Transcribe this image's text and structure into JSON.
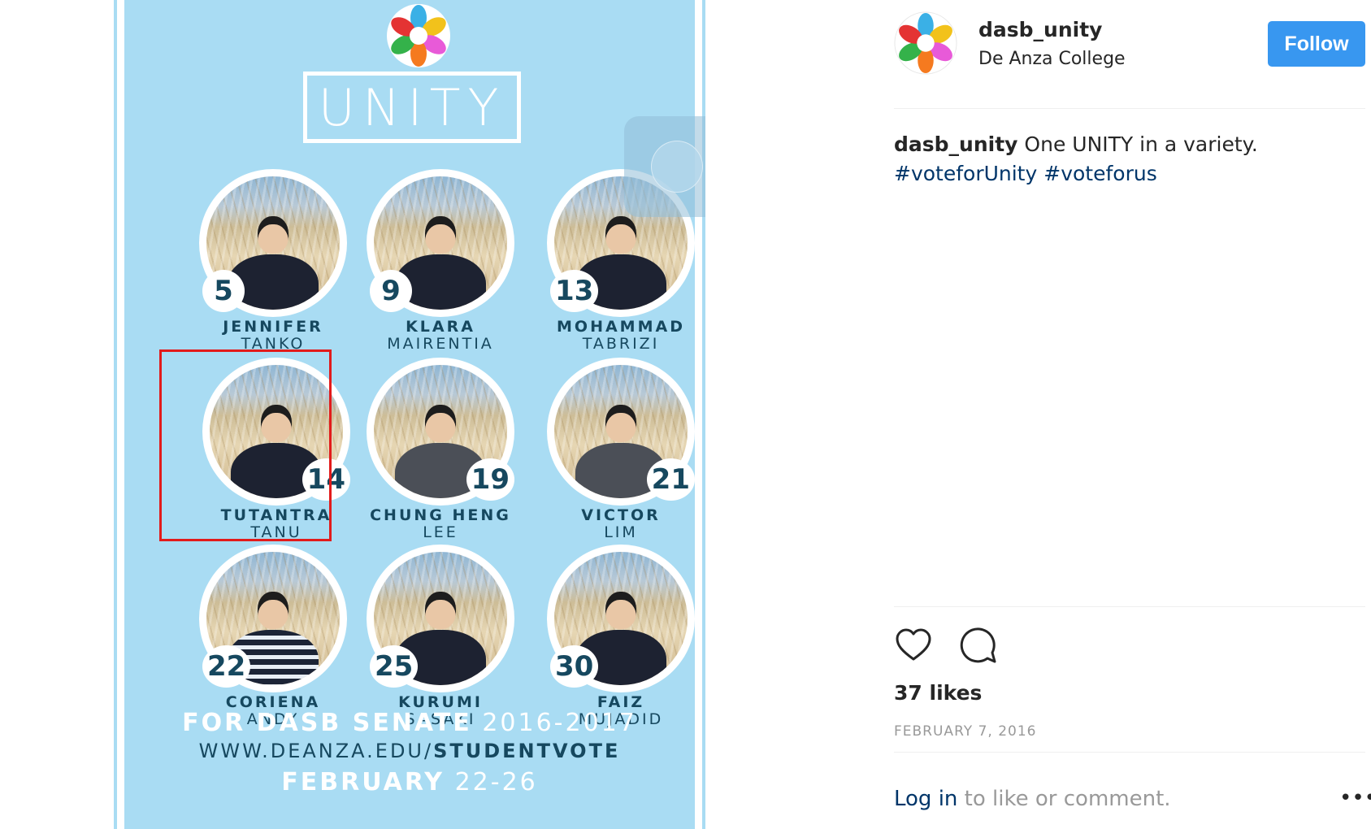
{
  "poster": {
    "title": "UNITY",
    "candidates": [
      {
        "number": "5",
        "first": "JENNIFER",
        "last": "TANKO"
      },
      {
        "number": "9",
        "first": "KLARA",
        "last": "MAIRENTIA"
      },
      {
        "number": "13",
        "first": "MOHAMMAD",
        "last": "TABRIZI"
      },
      {
        "number": "14",
        "first": "TUTANTRA",
        "last": "TANU"
      },
      {
        "number": "19",
        "first": "CHUNG HENG",
        "last": "LEE"
      },
      {
        "number": "21",
        "first": "VICTOR",
        "last": "LIM"
      },
      {
        "number": "22",
        "first": "CORIENA",
        "last": "ANDY"
      },
      {
        "number": "25",
        "first": "KURUMI",
        "last": "SASAKI"
      },
      {
        "number": "30",
        "first": "FAIZ",
        "last": "MUJADID"
      }
    ],
    "footer_bold": "FOR DASB SENATE",
    "footer_years": "2016-2017",
    "url_plain": "WWW.DEANZA.EDU/",
    "url_bold": "STUDENTVOTE",
    "dates_bold": "FEBRUARY",
    "dates_plain": "22-26",
    "colors": {
      "background": "#a9dcf3",
      "text_dark": "#16485f",
      "highlight": "#e21b1b"
    }
  },
  "post": {
    "username": "dasb_unity",
    "location": "De Anza College",
    "follow_label": "Follow",
    "caption_username": "dasb_unity",
    "caption_text": " One UNITY in a variety.",
    "hashtags": [
      "#voteforUnity",
      "#voteforus"
    ],
    "likes": "37 likes",
    "date": "FEBRUARY 7, 2016",
    "login_link": "Log in",
    "login_rest": " to like or comment.",
    "more_label": "•••",
    "icons": [
      "heart-icon",
      "comment-icon",
      "more-options-icon"
    ],
    "colors": {
      "follow": "#3897f0",
      "link": "#003569",
      "muted": "#999999"
    }
  }
}
